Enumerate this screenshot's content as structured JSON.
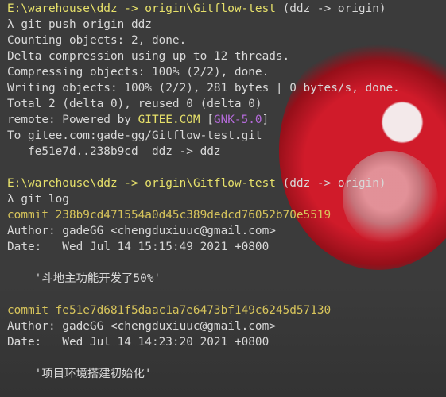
{
  "session1": {
    "path": "E:\\warehouse\\ddz",
    "arrow": "->",
    "origin_path": "origin\\Gitflow-test",
    "branch_info": "(ddz -> origin)",
    "command": "λ git push origin ddz",
    "output": [
      "Counting objects: 2, done.",
      "Delta compression using up to 12 threads.",
      "Compressing objects: 100% (2/2), done.",
      "Writing objects: 100% (2/2), 281 bytes | 0 bytes/s, done.",
      "Total 2 (delta 0), reused 0 (delta 0)"
    ],
    "remote_prefix": "remote: Powered by ",
    "remote_gitee": "GITEE.COM",
    "remote_bracket_open": " [",
    "remote_gnk": "GNK-5.0",
    "remote_bracket_close": "]",
    "to_line": "To gitee.com:gade-gg/Gitflow-test.git",
    "ref_line": "   fe51e7d..238b9cd  ddz -> ddz"
  },
  "session2": {
    "path": "E:\\warehouse\\ddz",
    "arrow": "->",
    "origin_path": "origin\\Gitflow-test",
    "branch_info": "(ddz -> origin)",
    "command": "λ git log"
  },
  "log": [
    {
      "commit": "commit 238b9cd471554a0d45c389dedcd76052b70e5519",
      "author": "Author: gadeGG <chengduxiuuc@gmail.com>",
      "date": "Date:   Wed Jul 14 15:15:49 2021 +0800",
      "message": "    '斗地主功能开发了50%'"
    },
    {
      "commit": "commit fe51e7d681f5daac1a7e6473bf149c6245d57130",
      "author": "Author: gadeGG <chengduxiuuc@gmail.com>",
      "date": "Date:   Wed Jul 14 14:23:20 2021 +0800",
      "message": "    '项目环境搭建初始化'"
    }
  ],
  "colors": {
    "background": "#3b3b3b",
    "text": "#d8d8d8",
    "yellow": "#e6e06a",
    "commit_yellow": "#d7c45b",
    "purple": "#b36ad8"
  }
}
